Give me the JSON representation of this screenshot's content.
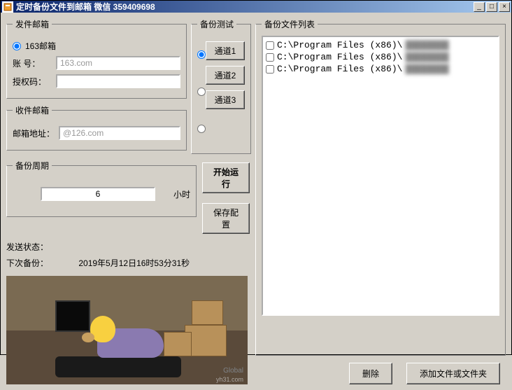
{
  "window": {
    "title": "定时备份文件到邮箱  微信  359409698"
  },
  "sender": {
    "legend": "发件邮箱",
    "provider_label": "163邮箱",
    "account_label": "账  号：",
    "account_value": "163.com",
    "auth_label": "授权码：",
    "auth_value": ""
  },
  "receiver": {
    "legend": "收件邮箱",
    "addr_label": "邮箱地址：",
    "addr_value": "@126.com"
  },
  "test": {
    "legend": "备份测试",
    "ch1": "通道1",
    "ch2": "通道2",
    "ch3": "通道3"
  },
  "cycle": {
    "legend": "备份周期",
    "value": "6",
    "unit": "小时"
  },
  "actions": {
    "start": "开始运行",
    "save": "保存配置"
  },
  "status": {
    "send_label": "发送状态：",
    "next_label": "下次备份：",
    "next_value": "2019年5月12日16时53分31秒"
  },
  "filelist": {
    "legend": "备份文件列表",
    "items": [
      "C:\\Program Files (x86)\\",
      "C:\\Program Files (x86)\\",
      "C:\\Program Files (x86)\\"
    ]
  },
  "bottom": {
    "delete": "删除",
    "add": "添加文件或文件夹"
  },
  "watermark": {
    "global": "Global",
    "site": "yh31.com"
  }
}
